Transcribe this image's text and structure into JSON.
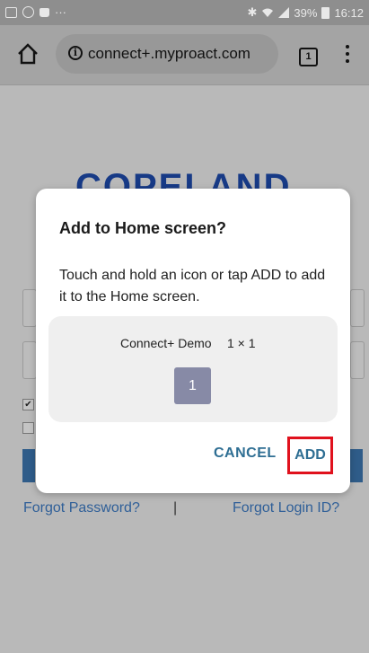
{
  "status_bar": {
    "left_icons": [
      "image-icon",
      "blocked-icon",
      "bag-icon",
      "more-icon"
    ],
    "more_glyph": "···",
    "bluetooth": "✱",
    "battery": "39%",
    "time": "16:12"
  },
  "browser": {
    "url": "connect+.myproact.com",
    "info_glyph": "i",
    "tab_count": "1"
  },
  "page": {
    "logo": "COPELAND",
    "remember_checked": "✔",
    "forgot_password": "Forgot Password?",
    "separator": "|",
    "forgot_login": "Forgot Login ID?"
  },
  "dialog": {
    "title": "Add to Home screen?",
    "body": "Touch and hold an icon or tap ADD to add it to the Home screen.",
    "shortcut_name": "Connect+ Demo",
    "shortcut_size": "1 × 1",
    "shortcut_icon_label": "1",
    "cancel_label": "CANCEL",
    "add_label": "ADD",
    "highlight_color": "#e0111d",
    "button_color": "#2e6e93"
  }
}
